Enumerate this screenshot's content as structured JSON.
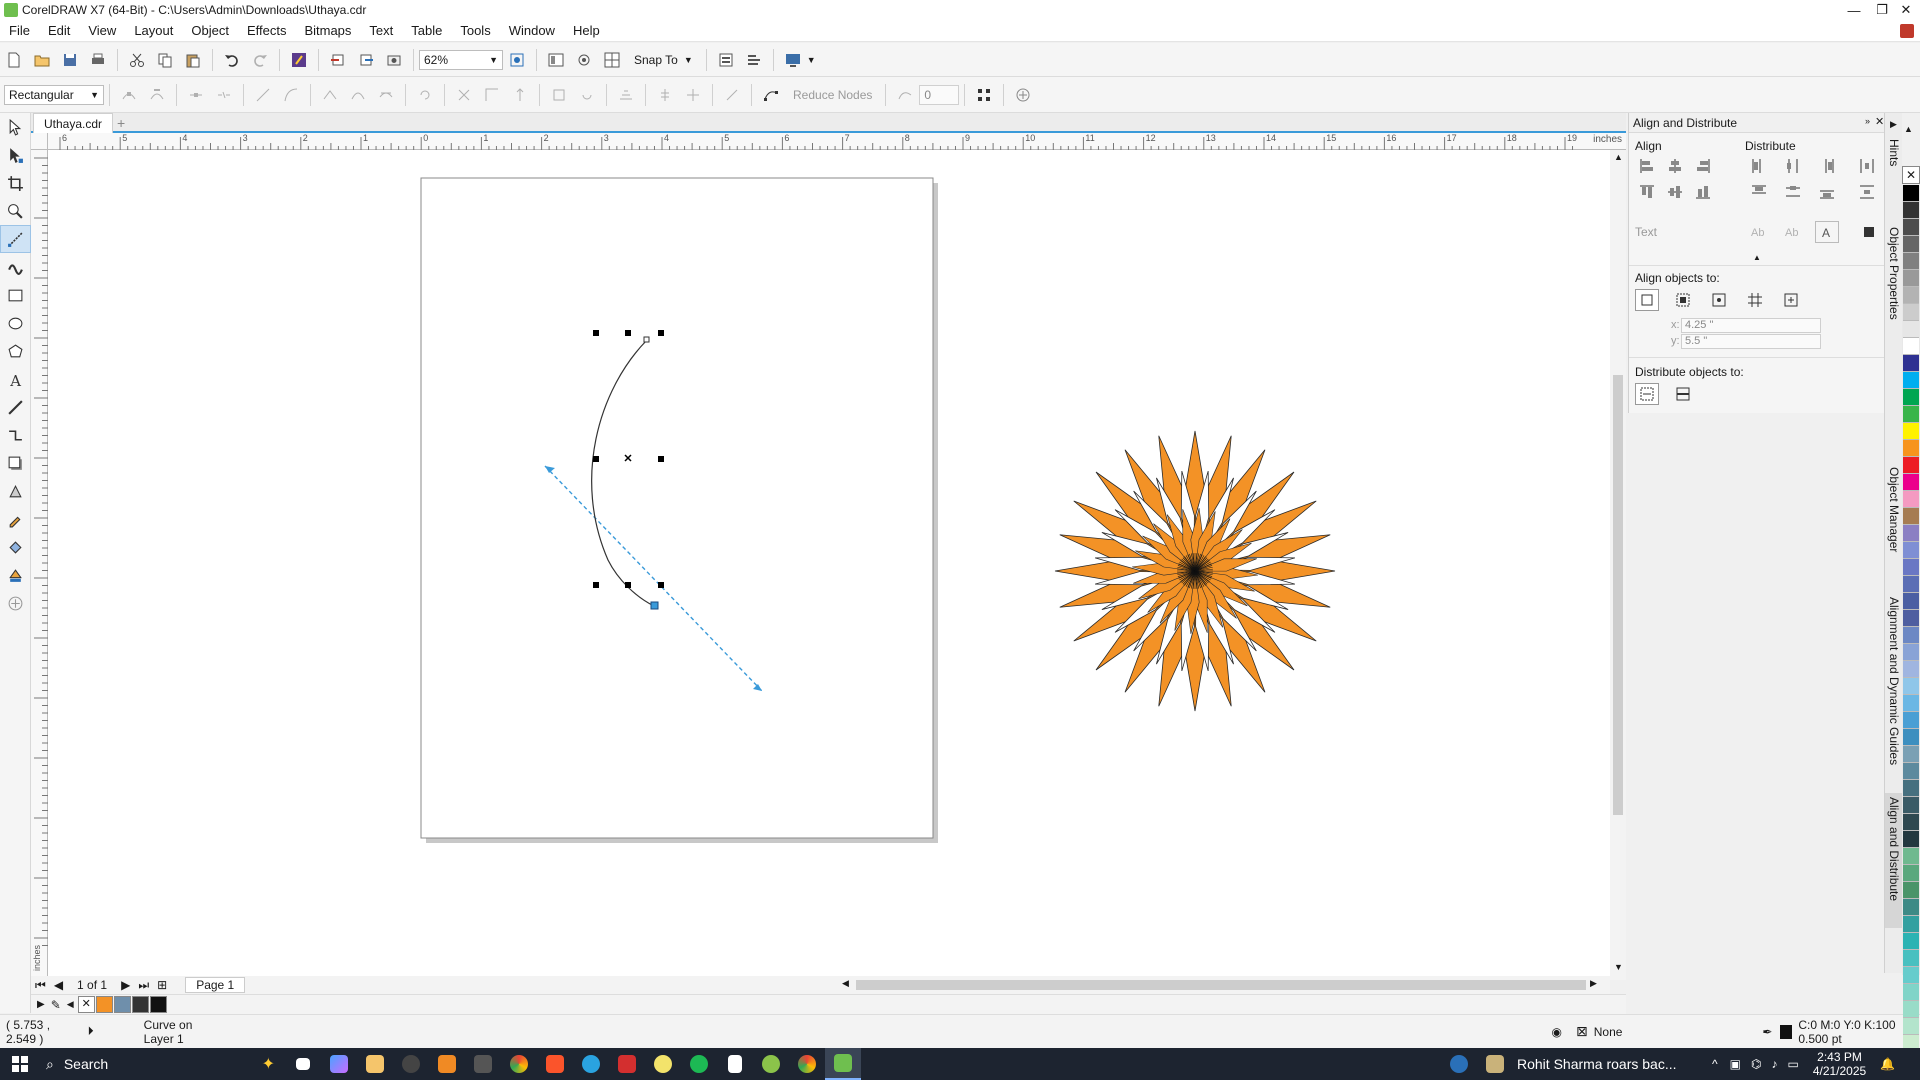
{
  "window": {
    "title": "CorelDRAW X7 (64-Bit) - C:\\Users\\Admin\\Downloads\\Uthaya.cdr",
    "minimize": "—",
    "maximize": "❐",
    "close": "✕"
  },
  "menu": [
    "File",
    "Edit",
    "View",
    "Layout",
    "Object",
    "Effects",
    "Bitmaps",
    "Text",
    "Table",
    "Tools",
    "Window",
    "Help"
  ],
  "toolbar": {
    "zoom": "62%",
    "snap_to": "Snap To"
  },
  "property_bar": {
    "shape_mode": "Rectangular",
    "reduce_nodes": "Reduce Nodes",
    "curve_smoothness": "0"
  },
  "document": {
    "tab": "Uthaya.cdr",
    "ruler_unit": "inches",
    "vruler_unit": "inches"
  },
  "ruler": {
    "h_labels": [
      "6",
      "5",
      "4",
      "3",
      "2",
      "1",
      "0",
      "1",
      "2",
      "3",
      "4",
      "5",
      "6",
      "7",
      "8",
      "9",
      "10",
      "11",
      "12",
      "13",
      "14",
      "15",
      "16",
      "17",
      "18",
      "19"
    ]
  },
  "page_nav": {
    "count": "1 of 1",
    "page_tab": "Page 1"
  },
  "docker": {
    "title": "Align and Distribute",
    "align_label": "Align",
    "distribute_label": "Distribute",
    "text_label": "Text",
    "align_to_label": "Align objects to:",
    "x_value": "4.25 \"",
    "y_value": "5.5 \"",
    "x_label": "x:",
    "y_label": "y:",
    "distribute_to_label": "Distribute objects to:"
  },
  "side_tabs": [
    "Hints",
    "Object Properties",
    "Object Manager",
    "Alignment and Dynamic Guides",
    "Align and Distribute"
  ],
  "status": {
    "coords": "( 5.753 , 2.549 )",
    "info": "Curve on Layer 1",
    "fill": "None",
    "outline": "C:0 M:0 Y:0 K:100  0.500 pt"
  },
  "taskbar": {
    "search": "Search",
    "news": "Rohit Sharma roars bac...",
    "time": "2:43 PM",
    "date": "4/21/2025"
  },
  "colors": {
    "accent": "#3a9ad9",
    "orange": "#f39226",
    "taskbar": "#1d2430"
  },
  "palette": [
    "#000000",
    "#333333",
    "#4d4d4d",
    "#666666",
    "#808080",
    "#999999",
    "#b3b3b3",
    "#cccccc",
    "#e6e6e6",
    "#ffffff",
    "#2e3192",
    "#00aeef",
    "#00a651",
    "#39b54a",
    "#fff200",
    "#f7941d",
    "#ed1c24",
    "#ec008c",
    "#f49ac1",
    "#a67c52",
    "#8b7fc3",
    "#7f8fd4",
    "#6a77c4",
    "#5b6eb5",
    "#4b5fa3",
    "#4e5ea0",
    "#6c88c4",
    "#89a3d6",
    "#a0b5e0",
    "#8fc6e9",
    "#6bb7e4",
    "#4a9fd4",
    "#3d8fbf",
    "#7aa0b4",
    "#5d8a9e",
    "#46707f",
    "#3a5b66",
    "#2e4850",
    "#23383f",
    "#6fb98f",
    "#5aa87d",
    "#4a9469",
    "#3d8a86",
    "#33a0a0",
    "#2bb3b3",
    "#48c0c0",
    "#66cccc",
    "#80d4c8",
    "#99dcc8",
    "#b3e4cc",
    "#cceccf"
  ],
  "doc_palette": [
    "none",
    "#f39226",
    "#6f8fab",
    "#333333",
    "#111111"
  ]
}
